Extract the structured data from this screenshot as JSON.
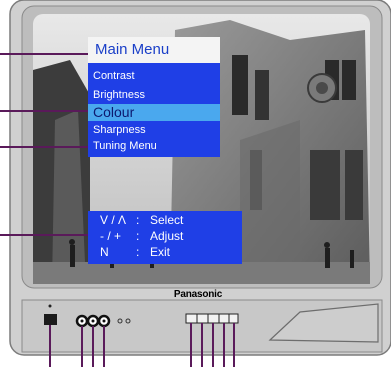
{
  "brand": "Panasonic",
  "main_menu": {
    "title": "Main Menu",
    "items": [
      {
        "label": "Contrast",
        "selected": false
      },
      {
        "label": "Brightness",
        "selected": false
      },
      {
        "label": "Colour",
        "selected": true
      },
      {
        "label": "Sharpness",
        "selected": false
      },
      {
        "label": "Tuning Menu",
        "selected": false
      }
    ]
  },
  "help": [
    {
      "key": "V / Λ",
      "sep": ":",
      "action": "Select"
    },
    {
      "key": "- / +",
      "sep": ":",
      "action": "Adjust"
    },
    {
      "key": "N",
      "sep": ":",
      "action": "Exit"
    }
  ],
  "colors": {
    "osd_blue": "#1f3fe6",
    "osd_highlight": "#4aa8ee",
    "title_bg": "#f4f4f4",
    "bezel": "#d2d2d2"
  }
}
